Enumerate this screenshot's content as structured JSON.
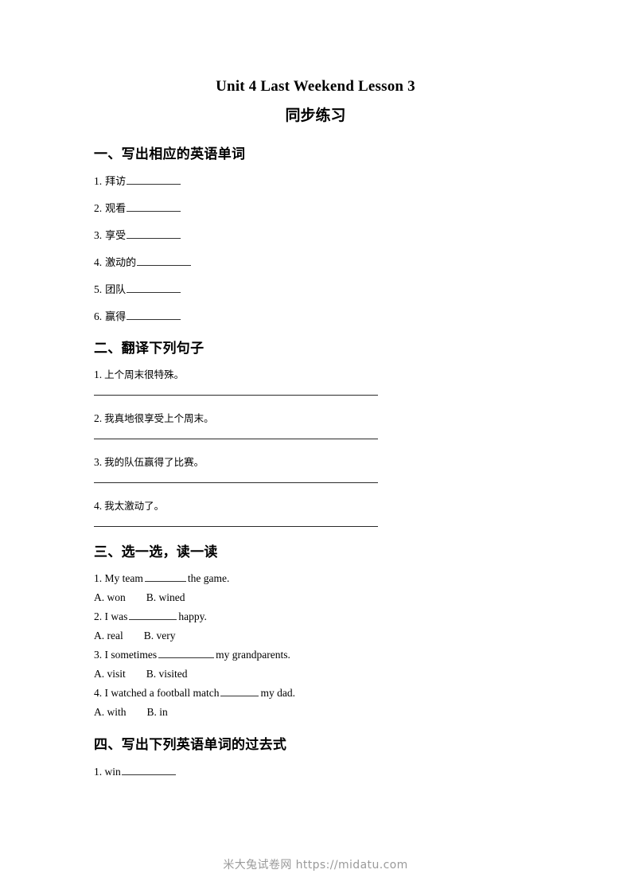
{
  "document": {
    "title": "Unit 4 Last Weekend Lesson 3",
    "subtitle": "同步练习"
  },
  "sections": [
    {
      "heading": "一、写出相应的英语单词",
      "items": [
        {
          "num": "1.",
          "cn": "拜访"
        },
        {
          "num": "2.",
          "cn": "观看"
        },
        {
          "num": "3.",
          "cn": "享受"
        },
        {
          "num": "4.",
          "cn": "激动的"
        },
        {
          "num": "5.",
          "cn": "团队"
        },
        {
          "num": "6.",
          "cn": "赢得"
        }
      ]
    },
    {
      "heading": "二、翻译下列句子",
      "items": [
        {
          "num": "1.",
          "cn": "上个周末很特殊。"
        },
        {
          "num": "2.",
          "cn": "我真地很享受上个周末。"
        },
        {
          "num": "3.",
          "cn": "我的队伍赢得了比赛。"
        },
        {
          "num": "4.",
          "cn": "我太激动了。"
        }
      ]
    },
    {
      "heading": "三、选一选，读一读",
      "items": [
        {
          "num": "1.",
          "pre": "1. My team",
          "post": "the game.",
          "option_a": "A. won",
          "option_b": "B. wined"
        },
        {
          "num": "2.",
          "pre": "2. I was",
          "post": "happy.",
          "option_a": "A. real",
          "option_b": "B. very"
        },
        {
          "num": "3.",
          "pre": "3. I sometimes",
          "post": "my grandparents.",
          "option_a": "A. visit",
          "option_b": "B. visited"
        },
        {
          "num": "4.",
          "pre": "4. I watched a football match",
          "post": "my dad.",
          "option_a": "A. with",
          "option_b": "B. in"
        }
      ]
    },
    {
      "heading": "四、写出下列英语单词的过去式",
      "items": [
        {
          "num": "1.",
          "word": "win"
        }
      ]
    }
  ],
  "footer": {
    "text": "米大兔试卷网 https://midatu.com"
  }
}
